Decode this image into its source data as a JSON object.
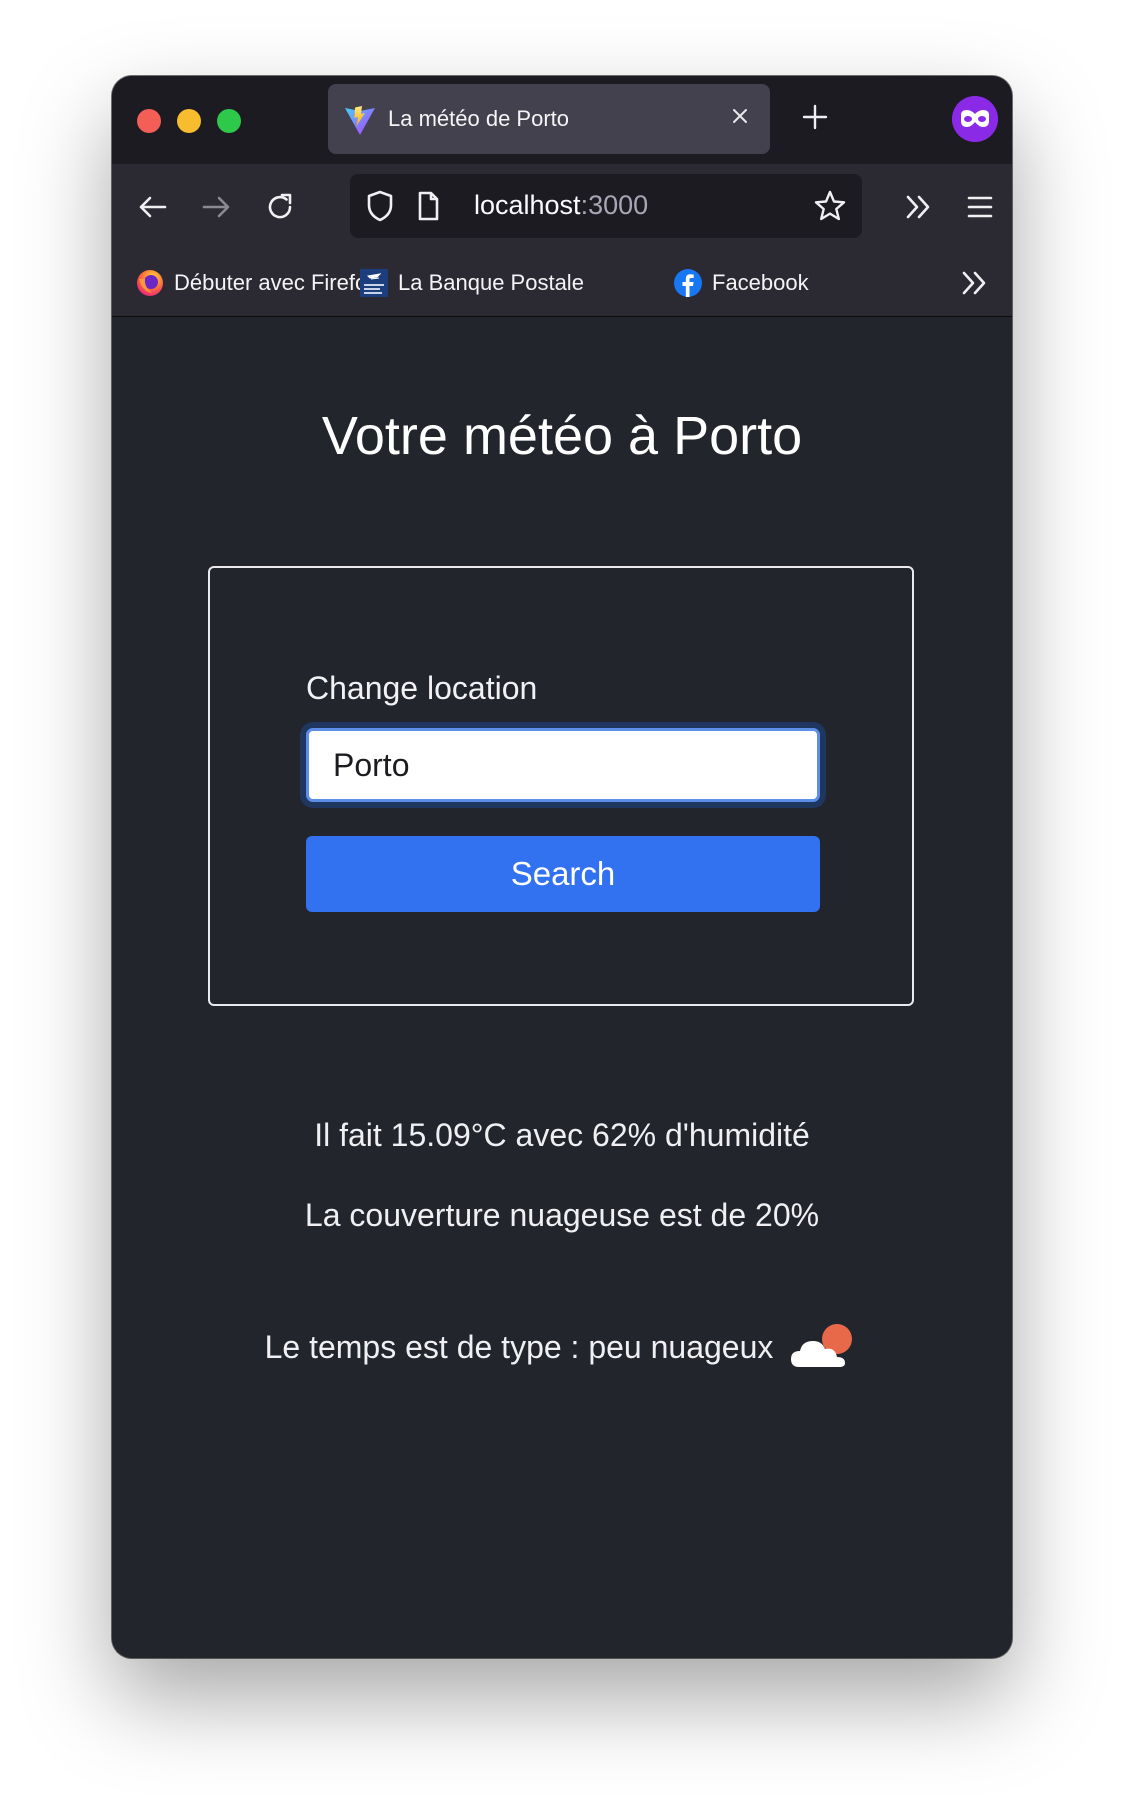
{
  "browser": {
    "tab": {
      "title": "La météo de Porto",
      "favicon": "vite-icon"
    },
    "address": {
      "host": "localhost",
      "port": ":3000"
    },
    "bookmarks": [
      {
        "label": "Débuter avec Firefox",
        "icon": "firefox-icon"
      },
      {
        "label": "La Banque Postale",
        "icon": "banque-postale-icon"
      },
      {
        "label": "Facebook",
        "icon": "facebook-icon"
      }
    ],
    "colors": {
      "tab_bar": "#1d1b22",
      "toolbar": "#2b2a33",
      "privacy_badge": "#8a2ae6"
    }
  },
  "page": {
    "title": "Votre météo à Porto",
    "form": {
      "label": "Change location",
      "input_value": "Porto",
      "button_label": "Search"
    },
    "weather": {
      "temperature_line": "Il fait 15.09°C avec 62% d'humidité",
      "cloud_line": "La couverture nuageuse est de 20%",
      "type_line": "Le temps est de type : peu nuageux",
      "icon": "partly-cloudy-icon"
    },
    "colors": {
      "background": "#22252c",
      "button": "#3271ef"
    }
  }
}
